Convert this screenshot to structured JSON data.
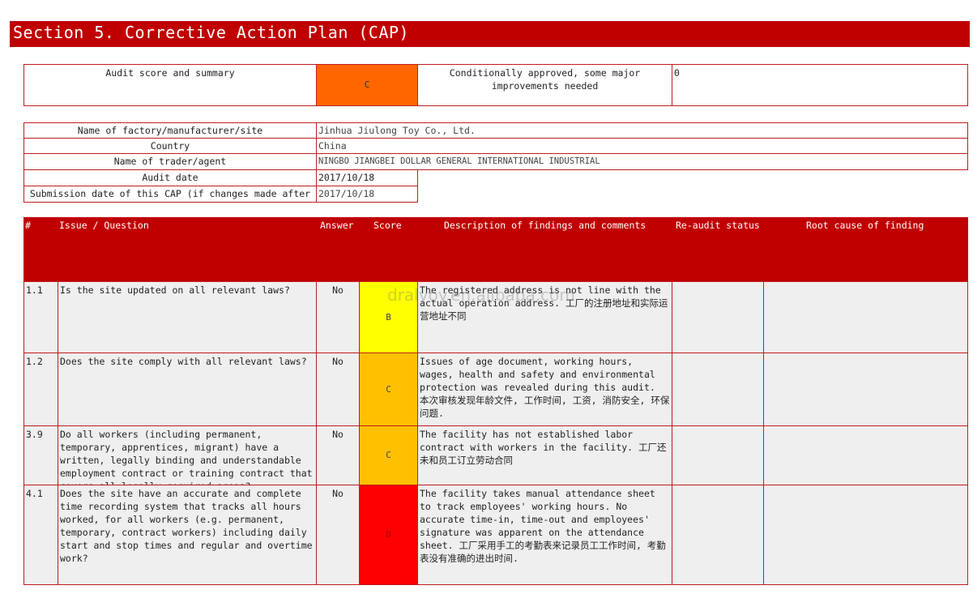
{
  "title": "Section 5. Corrective Action Plan (CAP)",
  "summary": {
    "label": "Audit score and summary",
    "grade": "C",
    "description": "Conditionally approved, some major improvements needed",
    "value": "0"
  },
  "info": {
    "factory_label": "Name of factory/manufacturer/site",
    "factory_value": "Jinhua Jiulong Toy Co., Ltd.",
    "country_label": "Country",
    "country_value": "China",
    "trader_label": "Name of trader/agent",
    "trader_value": "NINGBO JIANGBEI DOLLAR GENERAL INTERNATIONAL INDUSTRIAL",
    "audit_date_label": "Audit date",
    "audit_date_value": "2017/10/18",
    "submission_label": "Submission date of this CAP (if changes made after",
    "submission_value": "2017/10/18"
  },
  "table_headers": {
    "num": "#",
    "issue": "Issue / Question",
    "answer": "Answer",
    "score": "Score",
    "description": "Description of findings and comments",
    "reaudit": "Re-audit status",
    "root": "Root cause of finding"
  },
  "rows": [
    {
      "num": "1.1",
      "issue": "Is the site updated on all relevant laws?",
      "answer": "No",
      "score": "B",
      "score_color": "#ffff00",
      "description": "The registered address is not line with the actual operation address. 工厂的注册地址和实际运营地址不同"
    },
    {
      "num": "1.2",
      "issue": "Does the site comply with all relevant laws?",
      "answer": "No",
      "score": "C",
      "score_color": "#ffc000",
      "description": "Issues of age document, working hours, wages, health and safety and environmental protection was revealed during this audit. 本次审核发现年龄文件, 工作时间, 工资, 消防安全, 环保问题."
    },
    {
      "num": "3.9",
      "issue": "Do all workers (including permanent, temporary, apprentices, migrant) have a written, legally binding and understandable employment contract or training contract that covers all legally required areas?",
      "answer": "No",
      "score": "C",
      "score_color": "#ffc000",
      "description": "The facility has not established labor contract with workers in the facility. 工厂还未和员工订立劳动合同"
    },
    {
      "num": "4.1",
      "issue": "Does the site have an accurate and complete time recording system that tracks all hours worked, for all workers (e.g. permanent, temporary, contract workers) including daily start and stop times and regular and overtime work?",
      "answer": "No",
      "score": "D",
      "score_color": "#ff0000",
      "description": "The facility takes manual attendance sheet to track employees' working hours. No accurate time-in, time-out and employees' signature was apparent on the attendance sheet. 工厂采用手工的考勤表来记录员工工作时间, 考勤表没有准确的进出时间."
    }
  ],
  "watermark": "dralyoy.en.alibaba.com",
  "colors": {
    "title_bg": "#c00000",
    "border": "#c01d1d",
    "grade_c": "#ff6600"
  }
}
